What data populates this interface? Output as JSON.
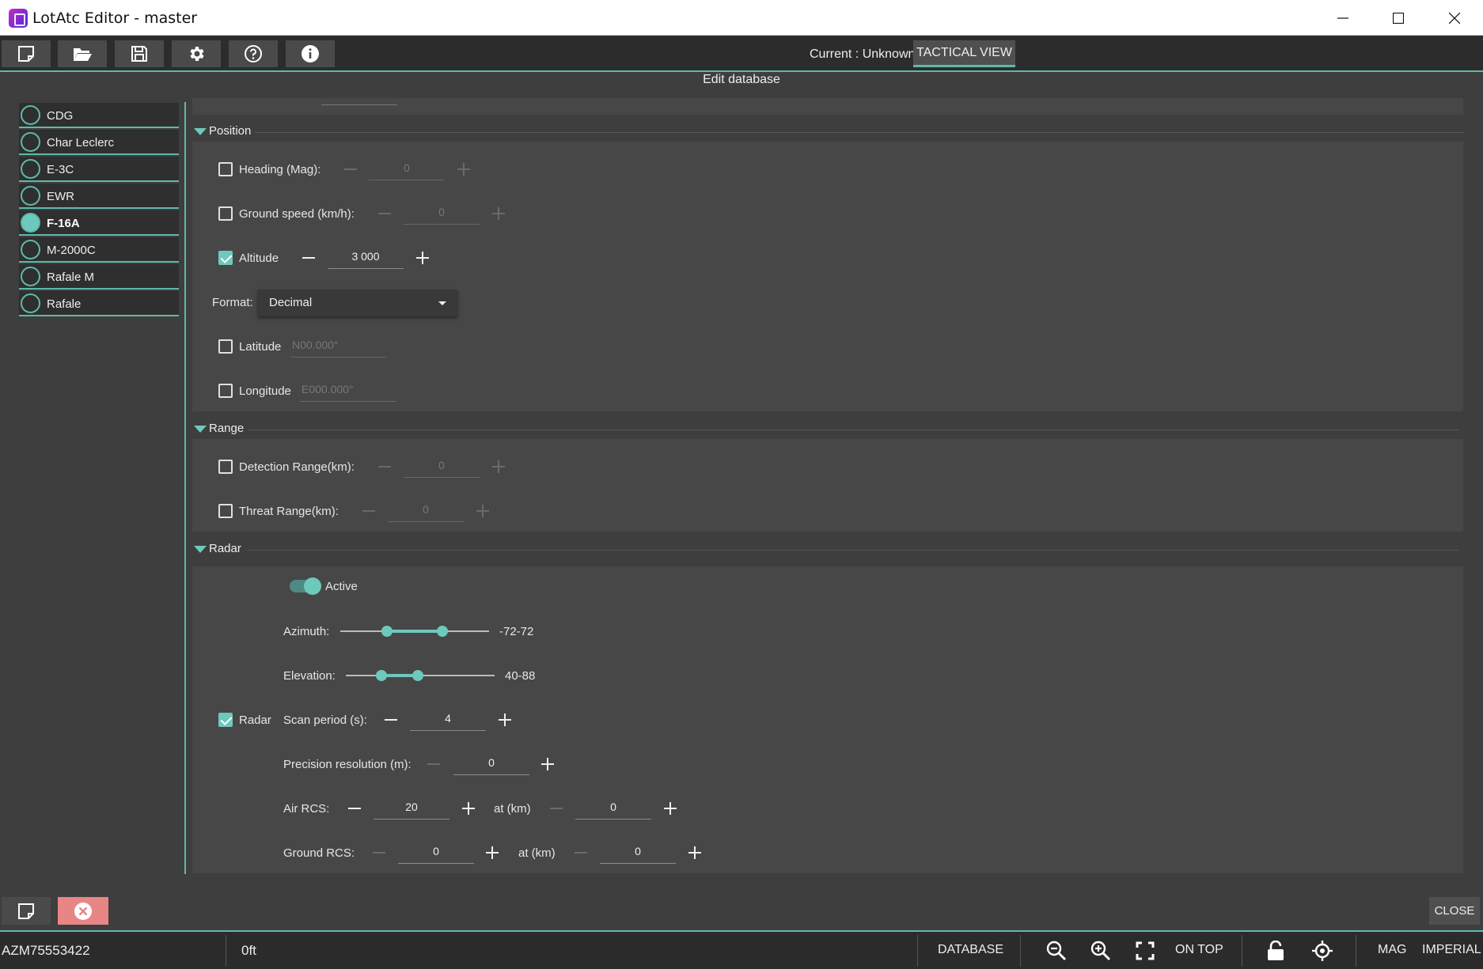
{
  "window": {
    "title": "LotAtc Editor - master"
  },
  "toolbar": {
    "buttons": [
      "new-file-icon",
      "open-folder-icon",
      "save-icon",
      "settings-icon",
      "help-icon",
      "info-icon"
    ],
    "current_label": "Current : Unknown",
    "tactical_view": "TACTICAL VIEW"
  },
  "header": {
    "title": "Edit database"
  },
  "sidebar": {
    "items": [
      {
        "label": "CDG",
        "selected": false
      },
      {
        "label": "Char Leclerc",
        "selected": false
      },
      {
        "label": "E-3C",
        "selected": false
      },
      {
        "label": "EWR",
        "selected": false
      },
      {
        "label": "F-16A",
        "selected": true
      },
      {
        "label": "M-2000C",
        "selected": false
      },
      {
        "label": "Rafale M",
        "selected": false
      },
      {
        "label": "Rafale",
        "selected": false
      }
    ]
  },
  "position": {
    "title": "Position",
    "heading": {
      "label": "Heading (Mag):",
      "value": "0",
      "checked": false
    },
    "ground_speed": {
      "label": "Ground speed (km/h):",
      "value": "0",
      "checked": false
    },
    "altitude": {
      "label": "Altitude",
      "value": "3 000",
      "checked": true
    },
    "format": {
      "label": "Format:",
      "value": "Decimal"
    },
    "latitude": {
      "label": "Latitude",
      "placeholder": "N00.000°",
      "checked": false
    },
    "longitude": {
      "label": "Longitude",
      "placeholder": "E000.000°",
      "checked": false
    }
  },
  "range": {
    "title": "Range",
    "detection": {
      "label": "Detection Range(km):",
      "value": "0",
      "checked": false
    },
    "threat": {
      "label": "Threat Range(km):",
      "value": "0",
      "checked": false
    }
  },
  "radar": {
    "title": "Radar",
    "active_label": "Active",
    "active": true,
    "azimuth": {
      "label": "Azimuth:",
      "value": "-72-72"
    },
    "elevation": {
      "label": "Elevation:",
      "value": "40-88"
    },
    "radar_label": "Radar",
    "radar_checked": true,
    "scan_period": {
      "label": "Scan period (s):",
      "value": "4"
    },
    "precision": {
      "label": "Precision resolution (m):",
      "value": "0"
    },
    "air_rcs": {
      "label": "Air RCS:",
      "value": "20",
      "at_label": "at (km)",
      "at_value": "0"
    },
    "ground_rcs": {
      "label": "Ground RCS:",
      "value": "0",
      "at_label": "at (km)",
      "at_value": "0"
    }
  },
  "footer": {
    "close": "CLOSE"
  },
  "statusbar": {
    "id": "AZM75553422",
    "altitude": "0ft",
    "database": "DATABASE",
    "on_top": "ON TOP",
    "mag": "MAG",
    "imperial": "IMPERIAL"
  },
  "colors": {
    "accent": "#5fb8ac",
    "background": "#3e3e3e",
    "panel": "#474747",
    "delete": "#e88585"
  }
}
